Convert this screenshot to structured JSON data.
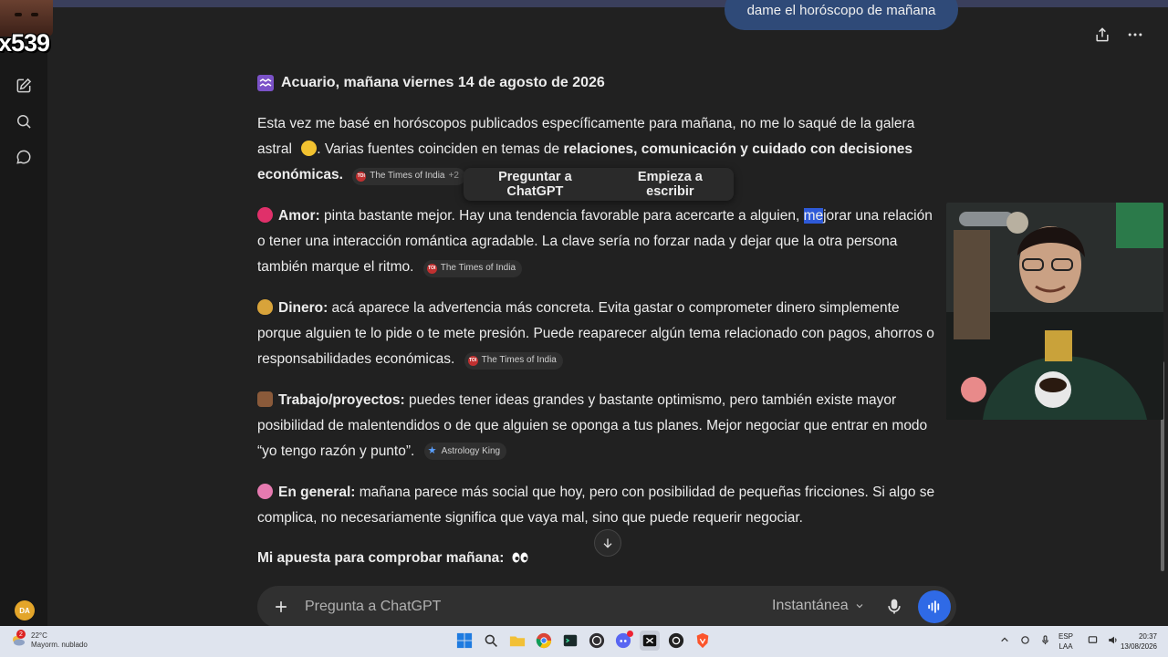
{
  "overlay": {
    "count": "x539"
  },
  "chat": {
    "user_message": "dame el horóscopo de mañana",
    "heading": "Acuario, mañana viernes 14 de agosto de 2026",
    "intro": {
      "t1": "Esta vez me basé en horóscopos publicados específicamente para mañana, no me lo saqué de la galera",
      "t2": "astral",
      "t3": ". Varias fuentes coinciden en temas de",
      "b1": "relaciones, comunicación y cuidado con decisiones",
      "b2": "económicas.",
      "source": "The Times of India",
      "source_extra": "+2"
    },
    "amor": {
      "label": "Amor:",
      "l1a": " pinta bastante mejor. Hay una tendencia favorable para acercarte a alguien, ",
      "l1_hl": "me",
      "l1b": "jorar una relación",
      "l2": "o tener una interacción romántica agradable. La clave sería no forzar nada y dejar que la otra persona",
      "l3": "también marque el ritmo.",
      "source": "The Times of India"
    },
    "dinero": {
      "label": "Dinero:",
      "l1": " acá aparece la advertencia más concreta. Evita gastar o comprometer dinero simplemente",
      "l2": "porque alguien te lo pide o te mete presión. Puede reaparecer algún tema relacionado con pagos, ahorros o",
      "l3": "responsabilidades económicas.",
      "source": "The Times of India"
    },
    "trabajo": {
      "label": "Trabajo/proyectos:",
      "l1": " puedes tener ideas grandes y bastante optimismo, pero también existe mayor",
      "l2": "posibilidad de malentendidos o de que alguien se oponga a tus planes. Mejor negociar que entrar en modo",
      "l3": "“yo tengo razón y punto”.",
      "source": "Astrology King"
    },
    "general": {
      "label": "En general:",
      "l1": " mañana parece más social que hoy, pero con posibilidad de pequeñas fricciones. Si algo se",
      "l2": "complica, no necesariamente significa que vaya mal, sino que puede requerir negociar."
    },
    "apuesta": {
      "label": "Mi apuesta para comprobar mañana:"
    }
  },
  "selection_menu": {
    "ask": "Preguntar a ChatGPT",
    "write": "Empieza a escribir"
  },
  "composer": {
    "placeholder": "Pregunta a ChatGPT",
    "model": "Instantánea"
  },
  "rail": {
    "avatar": "DA"
  },
  "taskbar": {
    "temp": "22°C",
    "weather": "Mayorm. nublado",
    "badge": "2",
    "lang1": "ESP",
    "lang2": "LAA",
    "time": "20:37",
    "date": "13/08/2026"
  },
  "colors": {
    "accent": "#2f6ae6",
    "background": "#212121",
    "user_bubble": "#2f4a78"
  }
}
